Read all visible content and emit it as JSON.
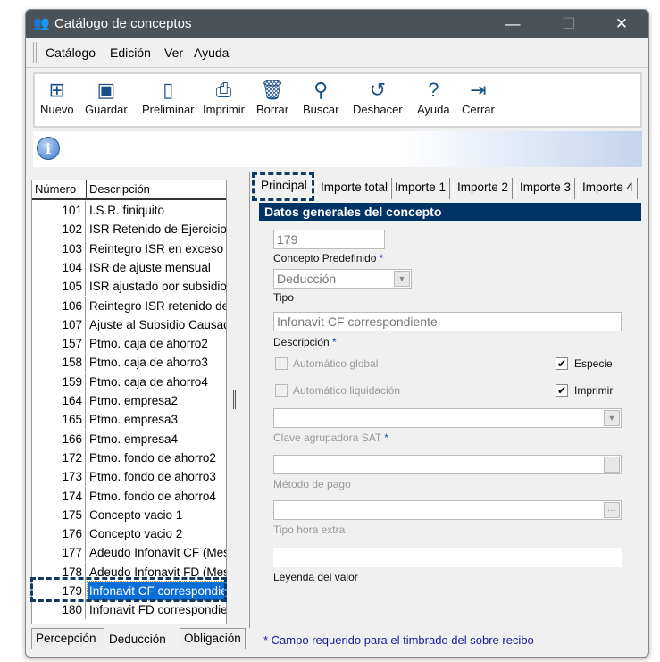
{
  "window": {
    "title": "Catálogo de conceptos",
    "minimize": "—",
    "maximize": "☐",
    "close": "✕"
  },
  "menu": [
    "Catálogo",
    "Edición",
    "Ver",
    "Ayuda"
  ],
  "toolbar": [
    {
      "label": "Nuevo",
      "icon": "new-file-icon",
      "glyph": "⊞"
    },
    {
      "label": "Guardar",
      "icon": "save-icon",
      "glyph": "▣"
    },
    {
      "label": "Preliminar",
      "icon": "preview-icon",
      "glyph": "▯"
    },
    {
      "label": "Imprimir",
      "icon": "printer-icon",
      "glyph": "⎙"
    },
    {
      "label": "Borrar",
      "icon": "trash-icon",
      "glyph": "🗑"
    },
    {
      "label": "Buscar",
      "icon": "search-icon",
      "glyph": "⚲"
    },
    {
      "label": "Deshacer",
      "icon": "undo-icon",
      "glyph": "↺"
    },
    {
      "label": "Ayuda",
      "icon": "help-icon",
      "glyph": "?"
    },
    {
      "label": "Cerrar",
      "icon": "exit-icon",
      "glyph": "⇥"
    }
  ],
  "info_glyph": "i",
  "list": {
    "headers": [
      "Número",
      "Descripción"
    ],
    "selected": "179",
    "rows": [
      [
        "101",
        "I.S.R. finiquito"
      ],
      [
        "102",
        "ISR Retenido de Ejercicio"
      ],
      [
        "103",
        "Reintegro ISR en exceso"
      ],
      [
        "104",
        "ISR de ajuste mensual"
      ],
      [
        "105",
        "ISR ajustado por subsidio"
      ],
      [
        "106",
        "Reintegro ISR retenido de"
      ],
      [
        "107",
        "Ajuste al Subsidio Causad"
      ],
      [
        "157",
        "Ptmo. caja de ahorro2"
      ],
      [
        "158",
        "Ptmo. caja de ahorro3"
      ],
      [
        "159",
        "Ptmo. caja de ahorro4"
      ],
      [
        "164",
        "Ptmo. empresa2"
      ],
      [
        "165",
        "Ptmo. empresa3"
      ],
      [
        "166",
        "Ptmo. empresa4"
      ],
      [
        "172",
        "Ptmo. fondo de ahorro2"
      ],
      [
        "173",
        "Ptmo. fondo de ahorro3"
      ],
      [
        "174",
        "Ptmo. fondo de ahorro4"
      ],
      [
        "175",
        "Concepto vacio 1"
      ],
      [
        "176",
        "Concepto vacio 2"
      ],
      [
        "177",
        "Adeudo Infonavit CF (Mes"
      ],
      [
        "178",
        "Adeudo Infonavit FD (Mes"
      ],
      [
        "179",
        "Infonavit CF correspondie"
      ],
      [
        "180",
        "Infonavit FD correspondie"
      ]
    ]
  },
  "bottom_tabs": [
    "Percepción",
    "Deducción",
    "Obligación"
  ],
  "tabs": [
    "Principal",
    "Importe total",
    "Importe 1",
    "Importe 2",
    "Importe 3",
    "Importe 4"
  ],
  "form": {
    "section": "Datos generales del concepto",
    "concepto_value": "179",
    "concepto_label": "Concepto Predefinido",
    "tipo_value": "Deducción",
    "tipo_label": "Tipo",
    "descripcion_value": "Infonavit CF correspondiente",
    "descripcion_label": "Descripción",
    "auto_global": "Automático global",
    "auto_liquidacion": "Automático liquidación",
    "especie": "Especie",
    "imprimir": "Imprimir",
    "check": "✔",
    "clave_label": "Clave agrupadora SAT",
    "metodo_label": "Método de pago",
    "hora_label": "Tipo hora extra",
    "leyenda_label": "Leyenda del valor",
    "required": "*",
    "ellipsis": "···",
    "arrow": "▼"
  },
  "footer": "* Campo requerido para el timbrado del sobre recibo"
}
